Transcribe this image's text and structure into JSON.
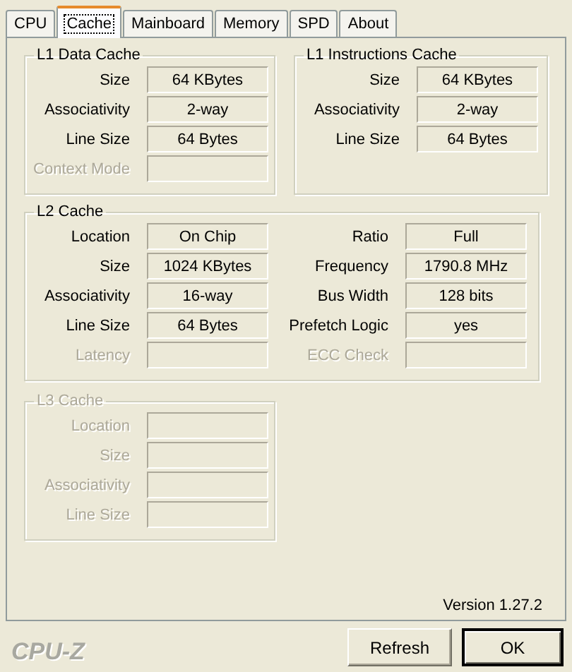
{
  "tabs": [
    {
      "label": "CPU",
      "selected": false
    },
    {
      "label": "Cache",
      "selected": true
    },
    {
      "label": "Mainboard",
      "selected": false
    },
    {
      "label": "Memory",
      "selected": false
    },
    {
      "label": "SPD",
      "selected": false
    },
    {
      "label": "About",
      "selected": false
    }
  ],
  "groups": [
    {
      "title": "L1 Data Cache",
      "disabled": false,
      "columns": [
        [
          {
            "label": "Size",
            "value": "64 KBytes",
            "disabled": false
          },
          {
            "label": "Associativity",
            "value": "2-way",
            "disabled": false
          },
          {
            "label": "Line Size",
            "value": "64 Bytes",
            "disabled": false
          },
          {
            "label": "Context Mode",
            "disabled": true
          }
        ]
      ]
    },
    {
      "title": "L1 Instructions Cache",
      "disabled": false,
      "columns": [
        [
          {
            "label": "Size",
            "value": "64 KBytes",
            "disabled": false
          },
          {
            "label": "Associativity",
            "value": "2-way",
            "disabled": false
          },
          {
            "label": "Line Size",
            "value": "64 Bytes",
            "disabled": false
          }
        ]
      ]
    },
    {
      "title": "L2 Cache",
      "disabled": false,
      "columns": [
        [
          {
            "label": "Location",
            "value": "On Chip",
            "disabled": false
          },
          {
            "label": "Size",
            "value": "1024 KBytes",
            "disabled": false
          },
          {
            "label": "Associativity",
            "value": "16-way",
            "disabled": false
          },
          {
            "label": "Line Size",
            "value": "64 Bytes",
            "disabled": false
          },
          {
            "label": "Latency",
            "disabled": true
          }
        ],
        [
          {
            "label": "Ratio",
            "value": "Full",
            "disabled": false
          },
          {
            "label": "Frequency",
            "value": "1790.8 MHz",
            "disabled": false
          },
          {
            "label": "Bus Width",
            "value": "128 bits",
            "disabled": false
          },
          {
            "label": "Prefetch Logic",
            "value": "yes",
            "disabled": false
          },
          {
            "label": "ECC Check",
            "disabled": true
          }
        ]
      ]
    },
    {
      "title": "L3 Cache",
      "disabled": true,
      "columns": [
        [
          {
            "label": "Location",
            "disabled": true
          },
          {
            "label": "Size",
            "disabled": true
          },
          {
            "label": "Associativity",
            "disabled": true
          },
          {
            "label": "Line Size",
            "disabled": true
          }
        ]
      ]
    }
  ],
  "version": "Version 1.27.2",
  "logo": "CPU-Z",
  "buttons": [
    {
      "label": "Refresh",
      "default": false
    },
    {
      "label": "OK",
      "default": true
    }
  ]
}
